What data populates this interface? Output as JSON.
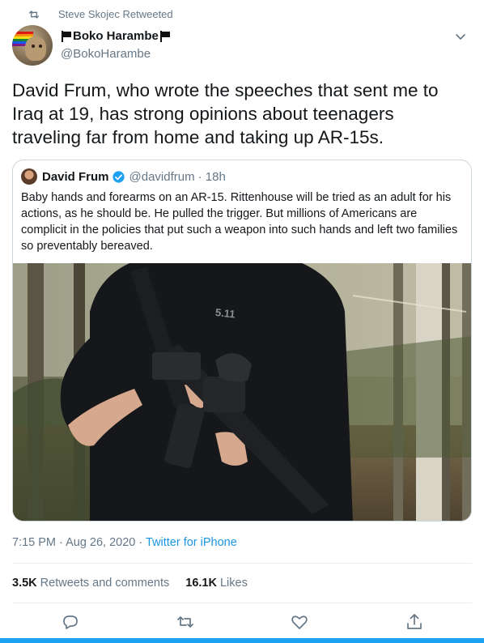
{
  "retweet_context": {
    "label": "Steve Skojec Retweeted",
    "icon": "retweet-icon"
  },
  "author": {
    "name": "Boko Harambe",
    "handle": "@BokoHarambe",
    "flag_icon": "black-flag-icon"
  },
  "tweet": {
    "text": "David Frum, who wrote the speeches that sent me to Iraq at 19, has strong opinions about teenagers traveling far from home and taking up AR-15s."
  },
  "quoted_tweet": {
    "name": "David Frum",
    "handle": "@davidfrum",
    "time": "· 18h",
    "text": "Baby hands and forearms on an AR-15. Rittenhouse will be tried as an adult for his actions, as he should be. He pulled the trigger. But millions of Americans are complicit in the policies that put such a weapon into such hands and left two families so preventably bereaved.",
    "media_text": "5.11"
  },
  "meta": {
    "time": "7:15 PM · Aug 26, 2020 · ",
    "source": "Twitter for iPhone"
  },
  "stats": {
    "retweets_count": "3.5K",
    "retweets_label": "Retweets and comments",
    "likes_count": "16.1K",
    "likes_label": "Likes"
  },
  "colors": {
    "accent": "#1da1f2",
    "link": "#1b95e0",
    "muted": "#657786",
    "text": "#14171a",
    "border": "#ccd6dd"
  }
}
